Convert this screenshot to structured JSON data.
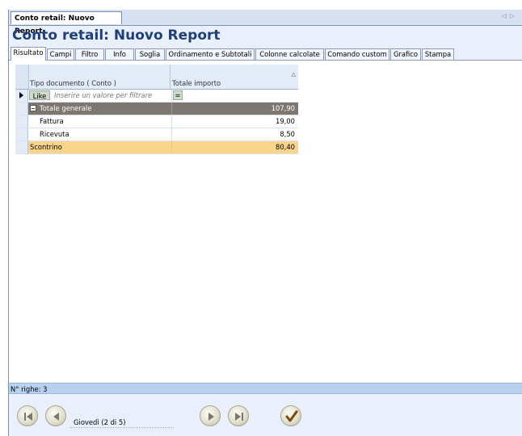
{
  "window": {
    "doc_tab": "Conto retail: Nuovo Report",
    "title": "Conto retail: Nuovo Report"
  },
  "tabs": [
    {
      "label": "Risultato"
    },
    {
      "label": "Campi"
    },
    {
      "label": "Filtro"
    },
    {
      "label": "Info"
    },
    {
      "label": "Soglia"
    },
    {
      "label": "Ordinamento e Subtotali"
    },
    {
      "label": "Colonne calcolate"
    },
    {
      "label": "Comando custom"
    },
    {
      "label": "Grafico"
    },
    {
      "label": "Stampa"
    }
  ],
  "grid": {
    "col1_header": "Tipo documento ( Conto )",
    "col2_header": "Totale importo",
    "filter": {
      "operator": "Like",
      "placeholder": "Inserire un valore per filtrare",
      "value_operator": "="
    },
    "rows": [
      {
        "label": "Totale generale",
        "value": "107,90"
      },
      {
        "label": "Fattura",
        "value": "19,00"
      },
      {
        "label": "Ricevuta",
        "value": "8,50"
      },
      {
        "label": "Scontrino",
        "value": "80,40"
      }
    ]
  },
  "status": {
    "row_count": "N° righe: 3"
  },
  "navigation": {
    "current": "Giovedì (2 di 5)"
  },
  "colors": {
    "title": "#1e3f7a",
    "total_row": "#7d7671",
    "selected_row": "#fbd48c",
    "status_bar": "#b8d1ee"
  }
}
